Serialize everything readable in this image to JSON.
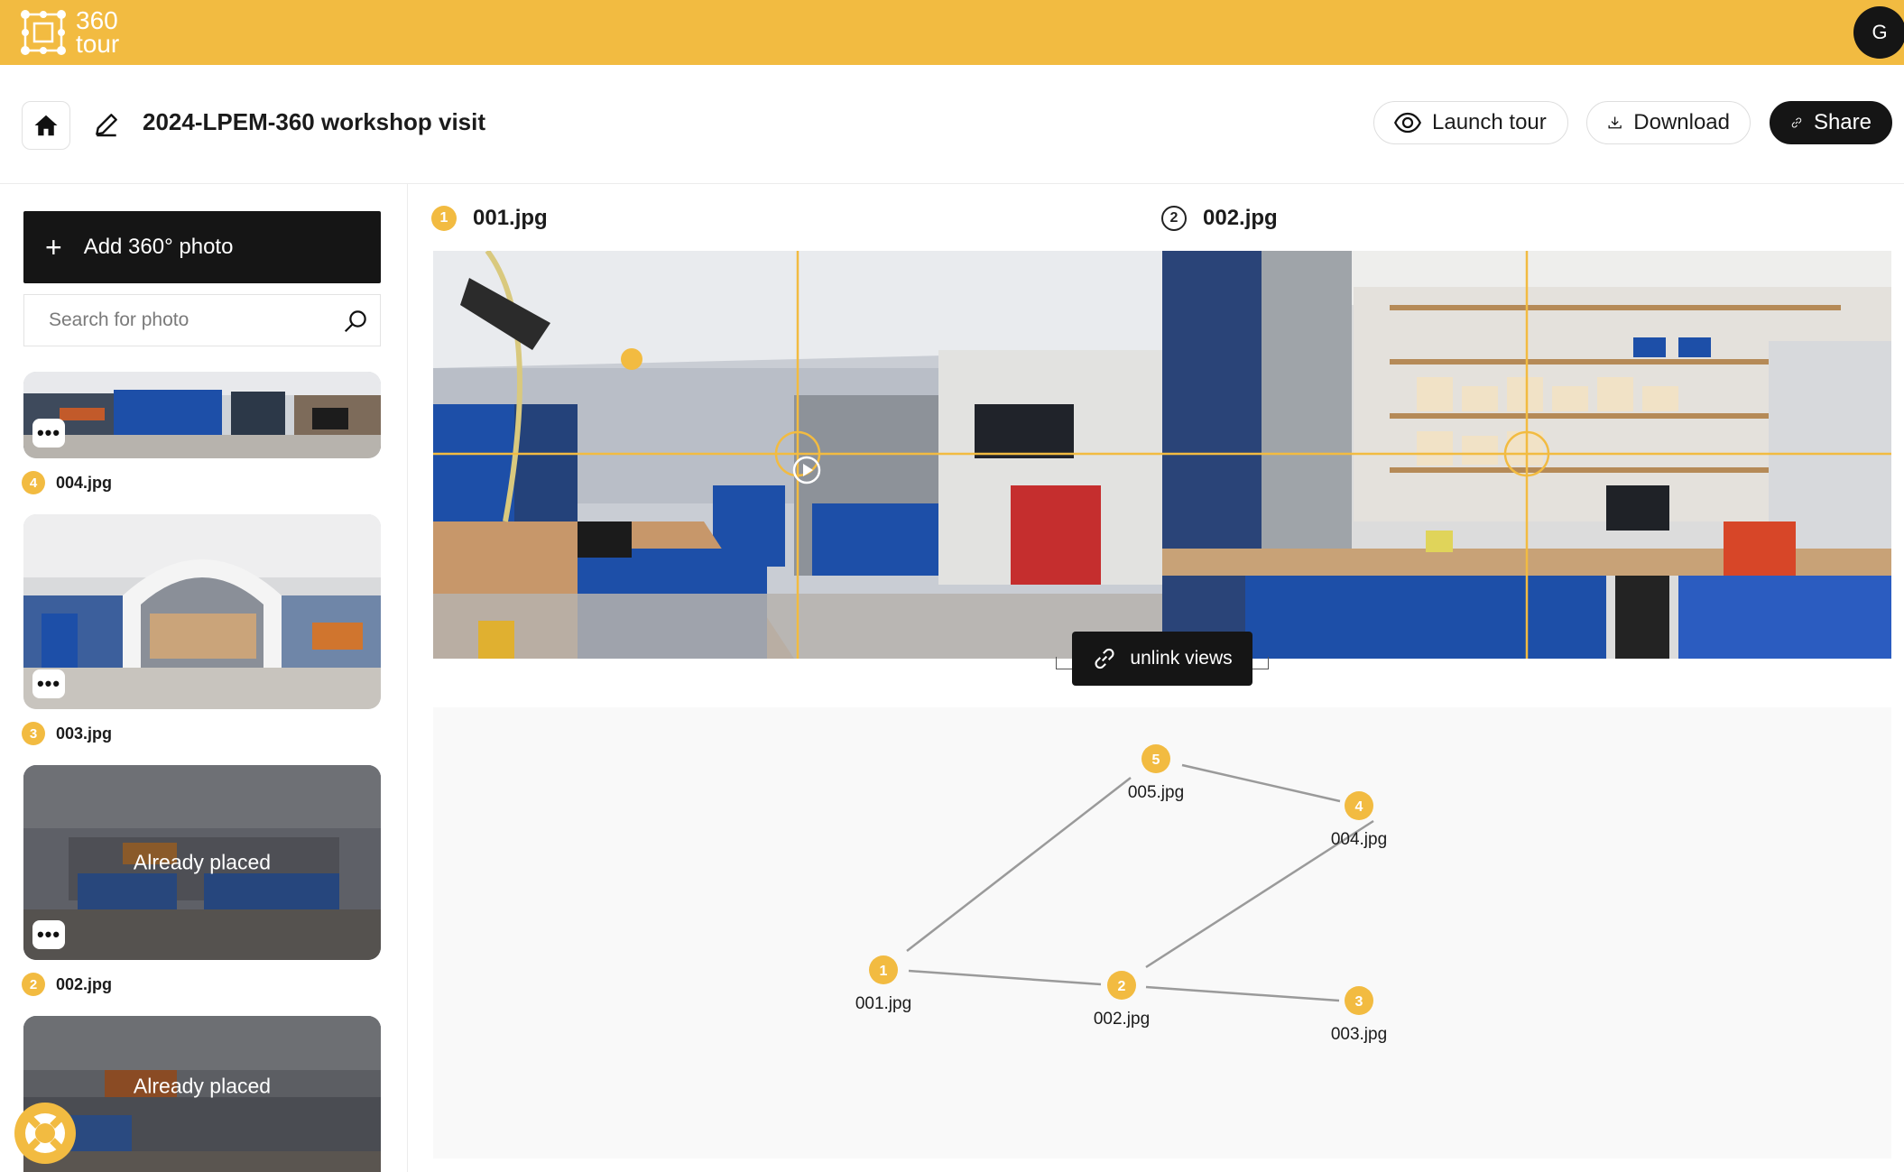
{
  "app": {
    "logo_line1": "360",
    "logo_line2": "tour",
    "user_initial": "G"
  },
  "header": {
    "title": "2024-LPEM-360 workshop visit",
    "launch_label": "Launch tour",
    "download_label": "Download",
    "share_label": "Share"
  },
  "sidebar": {
    "add_label": "Add 360° photo",
    "search_placeholder": "Search for photo",
    "photos": [
      {
        "num": "4",
        "name": "004.jpg",
        "status": ""
      },
      {
        "num": "3",
        "name": "003.jpg",
        "status": ""
      },
      {
        "num": "2",
        "name": "002.jpg",
        "status": "Already placed"
      },
      {
        "num": "",
        "name": "",
        "status": "Already placed"
      }
    ]
  },
  "viewer": {
    "left": {
      "num": "1",
      "name": "001.jpg"
    },
    "right": {
      "num": "2",
      "name": "002.jpg"
    },
    "unlink_label": "unlink views"
  },
  "graph": {
    "nodes": [
      {
        "id": "5",
        "label": "005.jpg"
      },
      {
        "id": "4",
        "label": "004.jpg"
      },
      {
        "id": "1",
        "label": "001.jpg"
      },
      {
        "id": "2",
        "label": "002.jpg"
      },
      {
        "id": "3",
        "label": "003.jpg"
      }
    ]
  },
  "colors": {
    "accent": "#f2bb41",
    "dark": "#151515",
    "workbench_blue": "#1d4fa8"
  }
}
